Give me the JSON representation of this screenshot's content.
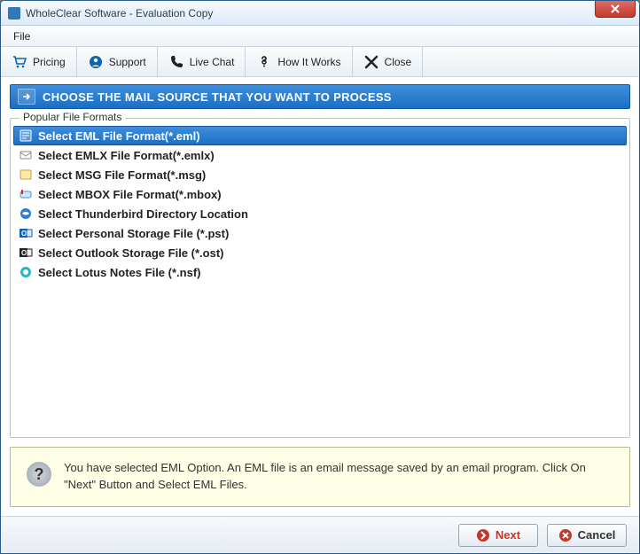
{
  "window": {
    "title": "WholeClear Software - Evaluation Copy"
  },
  "menubar": {
    "file": "File"
  },
  "toolbar": {
    "pricing": "Pricing",
    "support": "Support",
    "livechat": "Live Chat",
    "howitworks": "How It Works",
    "close": "Close"
  },
  "header": {
    "text": "CHOOSE THE MAIL SOURCE THAT YOU WANT TO PROCESS"
  },
  "group": {
    "label": "Popular File Formats"
  },
  "formats": [
    {
      "label": "Select EML File Format(*.eml)",
      "selected": true
    },
    {
      "label": "Select EMLX File Format(*.emlx)",
      "selected": false
    },
    {
      "label": "Select MSG File Format(*.msg)",
      "selected": false
    },
    {
      "label": "Select MBOX File Format(*.mbox)",
      "selected": false
    },
    {
      "label": "Select Thunderbird Directory Location",
      "selected": false
    },
    {
      "label": "Select Personal Storage File (*.pst)",
      "selected": false
    },
    {
      "label": "Select Outlook Storage File (*.ost)",
      "selected": false
    },
    {
      "label": "Select Lotus Notes File (*.nsf)",
      "selected": false
    }
  ],
  "info": {
    "text": "You have selected EML Option. An EML file is an email message saved by an email program. Click On \"Next\" Button and Select EML Files."
  },
  "footer": {
    "next": "Next",
    "cancel": "Cancel"
  }
}
